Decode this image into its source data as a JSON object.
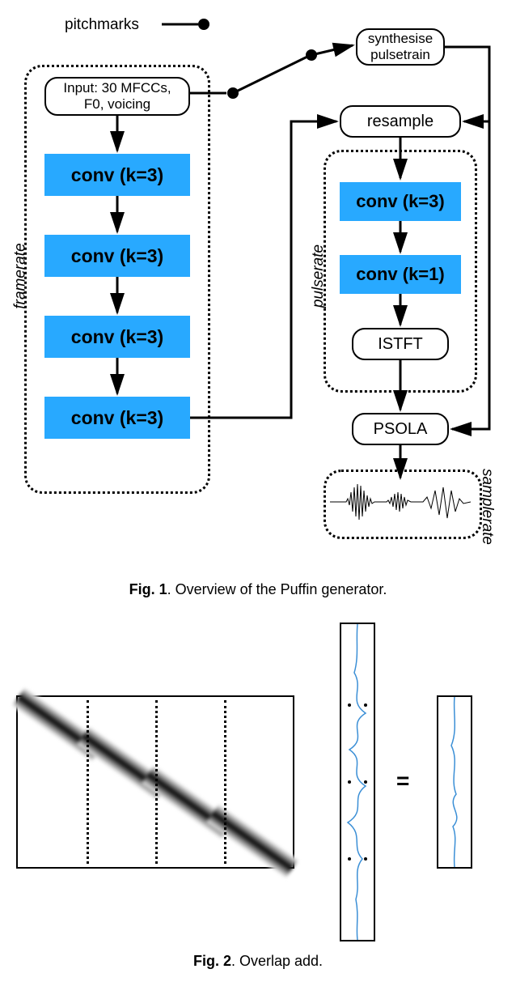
{
  "top": {
    "pitchmarks": "pitchmarks",
    "synth_line1": "synthesise",
    "synth_line2": "pulsetrain"
  },
  "left": {
    "sidelabel": "framerate",
    "input_line1": "Input: 30 MFCCs,",
    "input_line2": "F0, voicing",
    "conv1": "conv (k=3)",
    "conv2": "conv (k=3)",
    "conv3": "conv (k=3)",
    "conv4": "conv (k=3)"
  },
  "right": {
    "sidelabel_pulse": "pulserate",
    "sidelabel_sample": "samplerate",
    "resample": "resample",
    "conv1": "conv (k=3)",
    "conv2": "conv (k=1)",
    "istft": "ISTFT",
    "psola": "PSOLA"
  },
  "fig1_caption_bold": "Fig. 1",
  "fig1_caption_rest": ". Overview of the Puffin generator.",
  "fig2_caption_bold": "Fig. 2",
  "fig2_caption_rest": ". Overlap add.",
  "eq_sign": "="
}
